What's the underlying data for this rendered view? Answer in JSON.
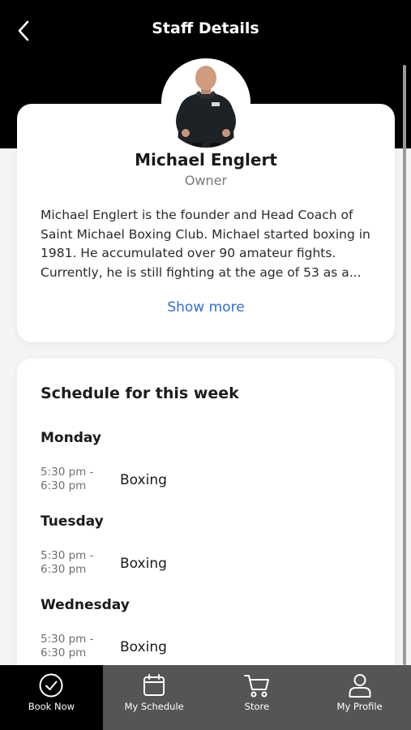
{
  "header": {
    "title": "Staff Details"
  },
  "staff": {
    "name": "Michael Englert",
    "role": "Owner",
    "bio": "Michael Englert is the founder and Head Coach of Saint Michael Boxing Club. Michael started boxing in 1981. He accumulated over 90 amateur fights. Currently, he is still fighting at the age of 53 as a...",
    "show_more_label": "Show more"
  },
  "schedule": {
    "title": "Schedule for this week",
    "days": [
      {
        "day": "Monday",
        "time_start": "5:30 pm -",
        "time_end": "6:30 pm",
        "class": "Boxing"
      },
      {
        "day": "Tuesday",
        "time_start": "5:30 pm -",
        "time_end": "6:30 pm",
        "class": "Boxing"
      },
      {
        "day": "Wednesday",
        "time_start": "5:30 pm -",
        "time_end": "6:30 pm",
        "class": "Boxing"
      }
    ]
  },
  "tabbar": {
    "items": [
      {
        "label": "Book Now",
        "icon": "check-circle-icon",
        "active": true
      },
      {
        "label": "My Schedule",
        "icon": "calendar-icon",
        "active": false
      },
      {
        "label": "Store",
        "icon": "cart-icon",
        "active": false
      },
      {
        "label": "My Profile",
        "icon": "person-icon",
        "active": false
      }
    ]
  },
  "colors": {
    "header_bg": "#000000",
    "link_blue": "#2f6fd6",
    "tabbar_bg": "#555555",
    "tab_active_bg": "#000000"
  }
}
